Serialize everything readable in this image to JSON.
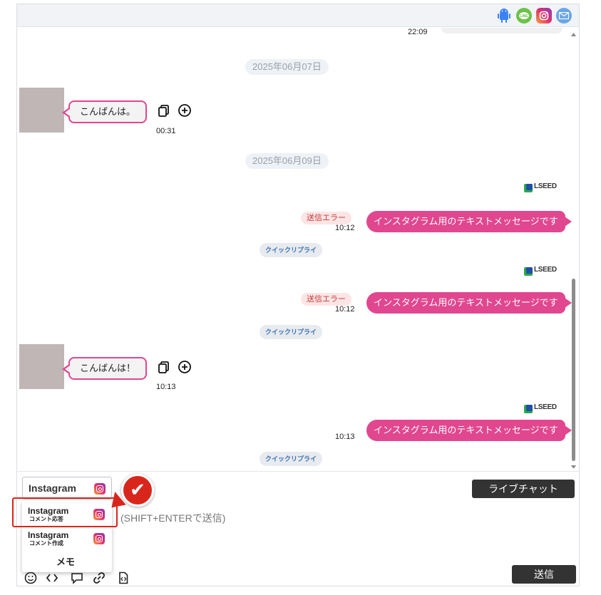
{
  "header": {
    "channels": [
      {
        "icon": "android-icon",
        "color": "#3ddc84"
      },
      {
        "icon": "line-icon",
        "color": "#06c755"
      },
      {
        "icon": "instagram-icon",
        "color": "#e1306c"
      },
      {
        "icon": "mail-icon",
        "color": "#4a90d9"
      }
    ]
  },
  "chat": {
    "top_partial_time": "22:09",
    "dates": [
      "2025年06月07日",
      "2025年06月09日"
    ],
    "incoming": [
      {
        "text": "こんばんは。",
        "time": "00:31"
      },
      {
        "text": "こんばんは！",
        "time": "10:13"
      }
    ],
    "outgoing": [
      {
        "text": "インスタグラム用のテキストメッセージです",
        "time": "10:12",
        "status": "送信エラー"
      },
      {
        "text": "インスタグラム用のテキストメッセージです",
        "time": "10:12",
        "status": "送信エラー"
      },
      {
        "text": "インスタグラム用のテキストメッセージです",
        "time": "10:13",
        "status": ""
      }
    ],
    "quick_reply_label": "クイックリプライ",
    "brand_logo_text": "LSEED"
  },
  "composer": {
    "channel_selected": "Instagram",
    "livechat_label": "ライブチャット",
    "placeholder": "(SHIFT+ENTERで送信)",
    "send_label": "送信",
    "dropdown": [
      {
        "title": "Instagram",
        "sub": "コメント応答"
      },
      {
        "title": "Instagram",
        "sub": "コメント作成"
      },
      {
        "title": "メモ",
        "sub": ""
      }
    ],
    "check_mark": "✔"
  },
  "colors": {
    "accent_pink": "#e0478f",
    "error_bg": "#fde5e5",
    "quick_reply_text": "#3c73b6",
    "dark_button": "#333333",
    "highlight_red": "#d9261c"
  }
}
